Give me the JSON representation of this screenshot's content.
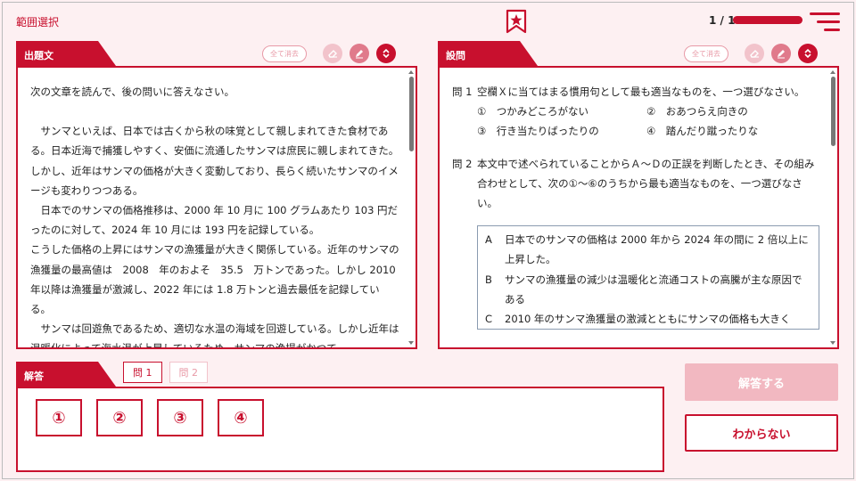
{
  "header": {
    "range_select": "範囲選択",
    "page_count": "1 / 1",
    "progress": 1.0
  },
  "passage": {
    "tab": "出題文",
    "clear_all": "全て消去",
    "paragraphs": [
      "次の文章を読んで、後の問いに答えなさい。",
      "",
      "　サンマといえば、日本では古くから秋の味覚として親しまれてきた食材である。日本近海で捕獲しやすく、安価に流通したサンマは庶民に親しまれてきた。しかし、近年はサンマの価格が大きく変動しており、長らく続いたサンマのイメージも変わりつつある。",
      "　日本でのサンマの価格推移は、2000 年 10 月に 100 グラムあたり 103 円だったのに対して、2024 年 10 月には 193 円を記録している。",
      "こうした価格の上昇にはサンマの漁獲量が大きく関係している。近年のサンマの漁獲量の最高値は　2008　年のおよそ　35.5　万トンであった。しかし 2010 年以降は漁獲量が激減し、2022 年には 1.8 万トンと過去最低を記録している。",
      "　サンマは回遊魚であるため、適切な水温の海域を回遊している。しかし近年は温暖化によって海水温が上昇しているため、サンマの漁場がかつて"
    ]
  },
  "questions": {
    "tab": "設問",
    "clear_all": "全て消去",
    "q1": {
      "num": "問 1",
      "text": "空欄Ｘに当てはまる慣用句として最も適当なものを、一つ選びなさい。",
      "choices": [
        "①　つかみどころがない",
        "②　おあつらえ向きの",
        "③　行き当たりばったりの",
        "④　踏んだり蹴ったりな"
      ]
    },
    "q2": {
      "num": "問 2",
      "text": "本文中で述べられていることからＡ～Ｄの正誤を判断したとき、その組み合わせとして、次の①～⑥のうちから最も適当なものを、一つ選びなさい。",
      "statements": [
        {
          "label": "A",
          "text": "日本でのサンマの価格は 2000 年から 2024 年の間に 2 倍以上に上昇した。"
        },
        {
          "label": "B",
          "text": "サンマの漁獲量の減少は温暖化と流通コストの高騰が主な原因である"
        },
        {
          "label": "C",
          "text": "2010 年のサンマ漁獲量の激減とともにサンマの価格も大きく"
        }
      ]
    }
  },
  "answer": {
    "tab": "解答",
    "q_tabs": [
      "問 1",
      "問 2"
    ],
    "options": [
      "①",
      "②",
      "③",
      "④"
    ],
    "submit": "解答する",
    "dont_know": "わからない"
  },
  "colors": {
    "accent": "#c8102e",
    "background": "#fdf0f2"
  }
}
